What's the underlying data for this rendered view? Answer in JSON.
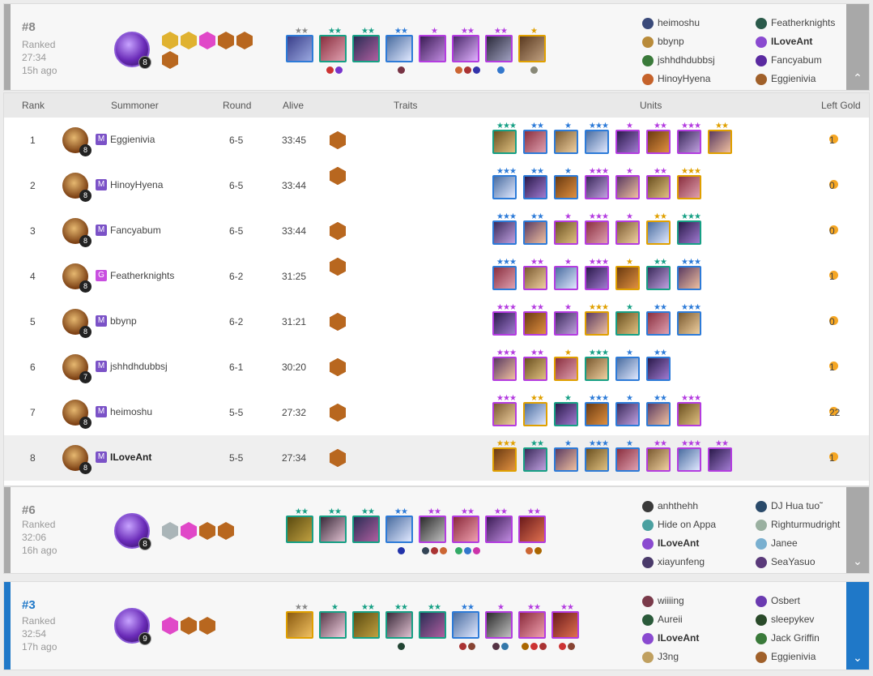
{
  "top_card": {
    "rank": "#8",
    "mode": "Ranked",
    "duration": "27:34",
    "ago": "15h ago",
    "level": "8",
    "players_left": [
      "heimoshu",
      "bbynp",
      "jshhdhdubbsj",
      "HinoyHyena"
    ],
    "players_right": [
      "Featherknights",
      "ILoveAnt",
      "Fancyabum",
      "Eggienivia"
    ],
    "toggle_icon": "⌃"
  },
  "table": {
    "headers": {
      "rank": "Rank",
      "summoner": "Summoner",
      "round": "Round",
      "alive": "Alive",
      "traits": "Traits",
      "units": "Units",
      "gold": "Left Gold"
    },
    "rows": [
      {
        "rank": "1",
        "name": "Eggienivia",
        "badge": "M",
        "level": "8",
        "round": "6-5",
        "alive": "33:45",
        "gold": "1"
      },
      {
        "rank": "2",
        "name": "HinoyHyena",
        "badge": "M",
        "level": "8",
        "round": "6-5",
        "alive": "33:44",
        "gold": "0"
      },
      {
        "rank": "3",
        "name": "Fancyabum",
        "badge": "M",
        "level": "8",
        "round": "6-5",
        "alive": "33:44",
        "gold": "0"
      },
      {
        "rank": "4",
        "name": "Featherknights",
        "badge": "G",
        "level": "8",
        "round": "6-2",
        "alive": "31:25",
        "gold": "1"
      },
      {
        "rank": "5",
        "name": "bbynp",
        "badge": "M",
        "level": "8",
        "round": "6-2",
        "alive": "31:21",
        "gold": "0"
      },
      {
        "rank": "6",
        "name": "jshhdhdubbsj",
        "badge": "M",
        "level": "7",
        "round": "6-1",
        "alive": "30:20",
        "gold": "1"
      },
      {
        "rank": "7",
        "name": "heimoshu",
        "badge": "M",
        "level": "8",
        "round": "5-5",
        "alive": "27:32",
        "gold": "22"
      },
      {
        "rank": "8",
        "name": "ILoveAnt",
        "badge": "M",
        "level": "8",
        "round": "5-5",
        "alive": "27:34",
        "gold": "1"
      }
    ]
  },
  "card6": {
    "rank": "#6",
    "mode": "Ranked",
    "duration": "32:06",
    "ago": "16h ago",
    "level": "8",
    "players_left": [
      "anhthehh",
      "Hide on Appa",
      "ILoveAnt",
      "xiayunfeng"
    ],
    "players_right": [
      "DJ Hua tuo˜",
      "Righturmudright",
      "Janee",
      "SeaYasuo"
    ],
    "toggle_icon": "⌄"
  },
  "card3": {
    "rank": "#3",
    "mode": "Ranked",
    "duration": "32:54",
    "ago": "17h ago",
    "level": "9",
    "players_left": [
      "wiiiing",
      "Aureii",
      "ILoveAnt",
      "J3ng"
    ],
    "players_right": [
      "Osbert",
      "sleepykev",
      "Jack Griffin",
      "Eggienivia"
    ],
    "toggle_icon": "⌄"
  },
  "colors": {
    "accent_blue": "#1f78c8",
    "gold": "#f5a623",
    "bronze_trait": "#b8671f"
  }
}
